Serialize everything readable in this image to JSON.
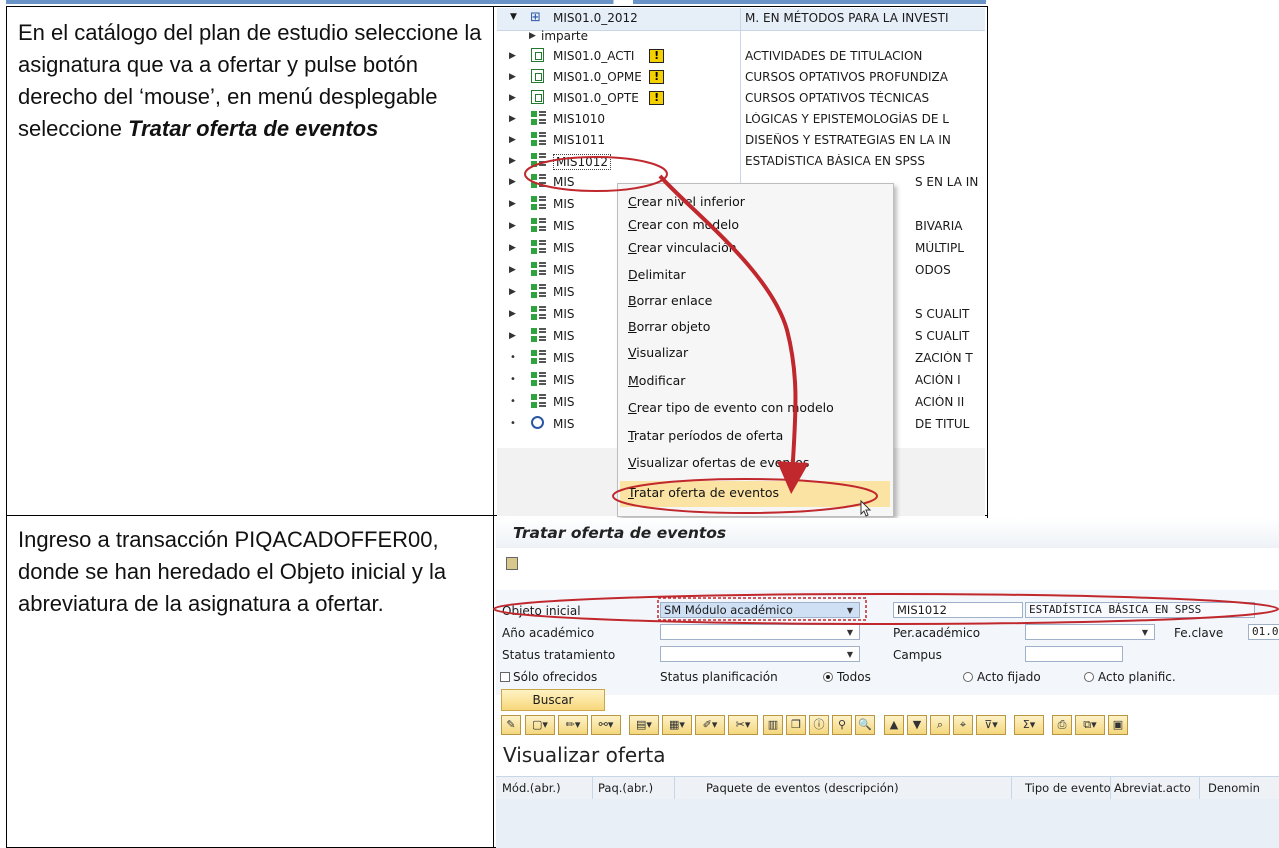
{
  "colors": {
    "annotation_red": "#c0282d",
    "menu_highlight": "#fbe3a3",
    "link_blue": "#4f81bd"
  },
  "step1": {
    "text_plain": "En el catálogo del plan de estudio seleccione la asignatura que va a ofertar y pulse botón derecho del ‘mouse’, en menú desplegable seleccione ",
    "text_emph": "Tratar oferta de eventos"
  },
  "step2": {
    "text": "Ingreso a transacción PIQACADOFFER00, donde se han heredado el Objeto inicial y la abreviatura de la asignatura a ofertar."
  },
  "tree": {
    "root": {
      "name": "MIS01.0_2012",
      "desc": "M. EN MÉTODOS PARA LA INVESTI",
      "icon": "structure-icon"
    },
    "imparte": "imparte",
    "rows": [
      {
        "name": "MIS01.0_ACTI",
        "desc": "ACTIVIDADES DE TITULACION",
        "icon": "module-group-icon",
        "warn": "!"
      },
      {
        "name": "MIS01.0_OPME",
        "desc": "CURSOS OPTATIVOS PROFUNDIZA",
        "icon": "module-group-icon",
        "warn": "!"
      },
      {
        "name": "MIS01.0_OPTE",
        "desc": "CURSOS OPTATIVOS TÉCNICAS",
        "icon": "module-group-icon",
        "warn": "!"
      },
      {
        "name": "MIS1010",
        "desc": "LÓGICAS Y EPISTEMOLOGÍAS DE L",
        "icon": "module-icon"
      },
      {
        "name": "MIS1011",
        "desc": "DISEÑOS Y ESTRATEGIAS EN LA IN",
        "icon": "module-icon"
      },
      {
        "name": "MIS1012",
        "desc": "ESTADÍSTICA BÁSICA EN SPSS",
        "icon": "module-icon"
      },
      {
        "name": "MIS",
        "desc": "S EN LA IN",
        "icon": "module-icon"
      },
      {
        "name": "MIS",
        "desc": "",
        "icon": "module-icon"
      },
      {
        "name": "MIS",
        "desc": "BIVARIA",
        "icon": "module-icon"
      },
      {
        "name": "MIS",
        "desc": "MÚLTIPL",
        "icon": "module-icon"
      },
      {
        "name": "MIS",
        "desc": "ODOS",
        "icon": "module-icon"
      },
      {
        "name": "MIS",
        "desc": "",
        "icon": "module-icon"
      },
      {
        "name": "MIS",
        "desc": "S CUALIT",
        "icon": "module-icon"
      },
      {
        "name": "MIS",
        "desc": "S CUALIT",
        "icon": "module-icon"
      },
      {
        "name": "MIS",
        "desc": "ZACIÓN T",
        "icon": "module-icon"
      },
      {
        "name": "MIS",
        "desc": "ACIÓN I",
        "icon": "module-icon"
      },
      {
        "name": "MIS",
        "desc": "ACIÓN II",
        "icon": "module-icon"
      },
      {
        "name": "MIS",
        "desc": "DE TITUL",
        "icon": "event-icon"
      }
    ]
  },
  "context_menu": {
    "items": [
      "Crear nivel inferior",
      "Crear con modelo",
      "Crear vinculación",
      "Delimitar",
      "Borrar enlace",
      "Borrar objeto",
      "Visualizar",
      "Modificar",
      "Crear tipo de evento con modelo",
      "Tratar períodos de oferta",
      "Visualizar ofertas de eventos",
      "Tratar oferta de eventos"
    ],
    "selected": "Tratar oferta de eventos"
  },
  "offer_screen": {
    "title": "Tratar oferta de eventos",
    "fields": {
      "objeto_inicial_label": "Objeto inicial",
      "objeto_inicial_value": "SM Módulo académico",
      "object_abbr": "MIS1012",
      "object_desc": "ESTADÍSTICA BÁSICA EN SPSS",
      "ano_label": "Año académico",
      "per_label": "Per.académico",
      "fe_label": "Fe.clave",
      "fe_value": "01.0",
      "status_label": "Status tratamiento",
      "campus_label": "Campus",
      "solo_label": "Sólo ofrecidos",
      "plan_label": "Status planificación",
      "radio_todos": "Todos",
      "radio_fijado": "Acto fijado",
      "radio_planific": "Acto planific."
    },
    "buscar": "Buscar",
    "visualizar": "Visualizar oferta",
    "columns": [
      "Mód.(abr.)",
      "Paq.(abr.)",
      "Paquete de eventos (descripción)",
      "Tipo de evento",
      "Abreviat.acto",
      "Denomin"
    ]
  }
}
